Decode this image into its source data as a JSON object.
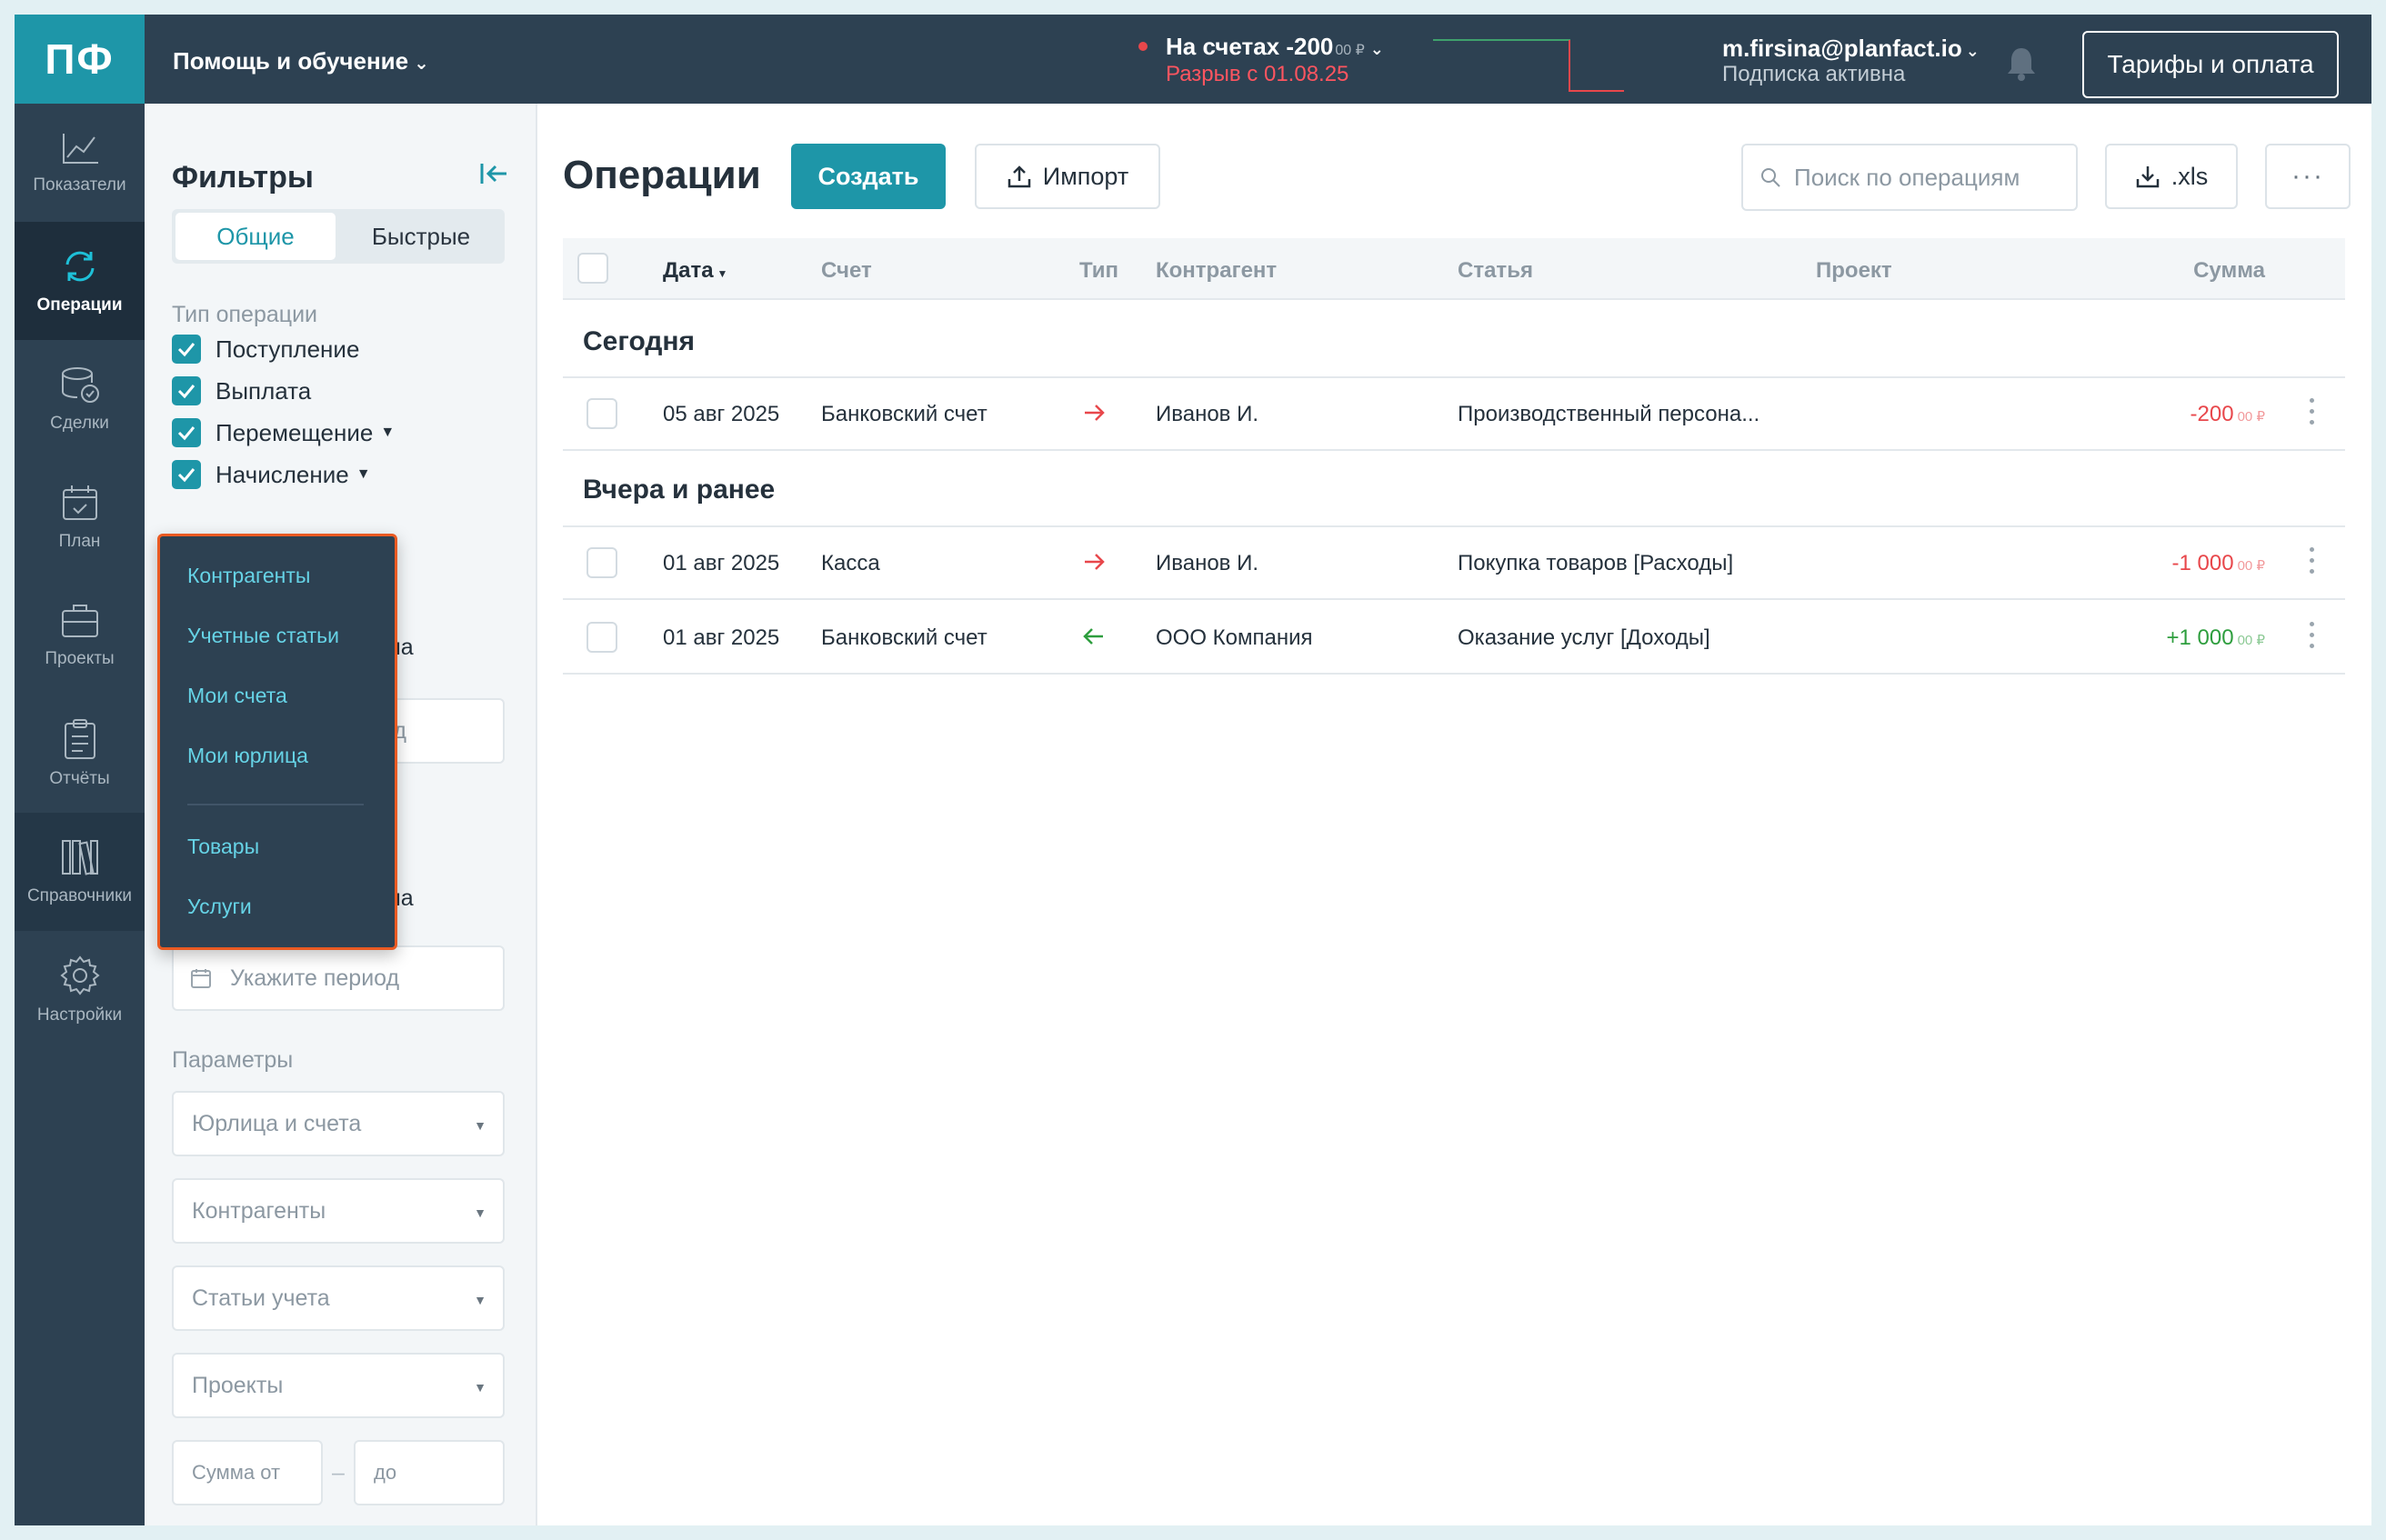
{
  "app": {
    "logo": "ПФ",
    "help_menu": "Помощь и обучение",
    "balance": {
      "label": "На счетах -200",
      "cents": "00 ₽",
      "gap_warning": "Разрыв с 01.08.25"
    },
    "user": {
      "email": "m.firsina@planfact.io",
      "subscription": "Подписка активна"
    },
    "tariff_button": "Тарифы и оплата"
  },
  "nav": {
    "items": [
      {
        "label": "Показатели",
        "icon": "chart-line-icon"
      },
      {
        "label": "Операции",
        "icon": "refresh-arrows-icon",
        "active": true
      },
      {
        "label": "Сделки",
        "icon": "coins-icon"
      },
      {
        "label": "План",
        "icon": "calendar-check-icon"
      },
      {
        "label": "Проекты",
        "icon": "briefcase-icon"
      },
      {
        "label": "Отчёты",
        "icon": "clipboard-icon"
      },
      {
        "label": "Справочники",
        "icon": "books-icon"
      },
      {
        "label": "Настройки",
        "icon": "gear-icon"
      }
    ]
  },
  "filters": {
    "title": "Фильтры",
    "tabs": [
      "Общие",
      "Быстрые"
    ],
    "operation_type_label": "Тип операции",
    "operation_types": [
      "Поступление",
      "Выплата",
      "Перемещение",
      "Начисление"
    ],
    "peek_text_1": "на",
    "peek_text_2": "од",
    "peek_text_3": "на",
    "period_placeholder": "Укажите период",
    "params_label": "Параметры",
    "selects": [
      "Юрлица и счета",
      "Контрагенты",
      "Статьи учета",
      "Проекты"
    ],
    "sum_from": "Сумма от",
    "sum_dash": "–",
    "sum_to": "до"
  },
  "directory_menu": {
    "items": [
      "Контрагенты",
      "Учетные статьи",
      "Мои счета",
      "Мои юрлица",
      "Товары",
      "Услуги"
    ]
  },
  "main": {
    "title": "Операции",
    "create_button": "Создать",
    "import_button": "Импорт",
    "search_placeholder": "Поиск по операциям",
    "xls_button": ".xls",
    "more_button": "···",
    "columns": [
      "Дата",
      "Счет",
      "Тип",
      "Контрагент",
      "Статья",
      "Проект",
      "Сумма"
    ],
    "groups": [
      {
        "title": "Сегодня",
        "rows": [
          {
            "date": "05 авг 2025",
            "account": "Банковский счет",
            "type": "out",
            "counterparty": "Иванов И.",
            "category": "Производственный персона...",
            "project": "",
            "amount": "-200",
            "cents": "00 ₽"
          }
        ]
      },
      {
        "title": "Вчера и ранее",
        "rows": [
          {
            "date": "01 авг 2025",
            "account": "Касса",
            "type": "out",
            "counterparty": "Иванов И.",
            "category": "Покупка товаров [Расходы]",
            "project": "",
            "amount": "-1 000",
            "cents": "00 ₽"
          },
          {
            "date": "01 авг 2025",
            "account": "Банковский счет",
            "type": "in",
            "counterparty": "ООО Компания",
            "category": "Оказание услуг [Доходы]",
            "project": "",
            "amount": "+1 000",
            "cents": "00 ₽"
          }
        ]
      }
    ]
  },
  "colors": {
    "accent": "#1e96a8",
    "nav_bg": "#2d4152",
    "negative": "#e8474b",
    "positive": "#2e9e3e",
    "menu_highlight": "#ea5a22"
  }
}
